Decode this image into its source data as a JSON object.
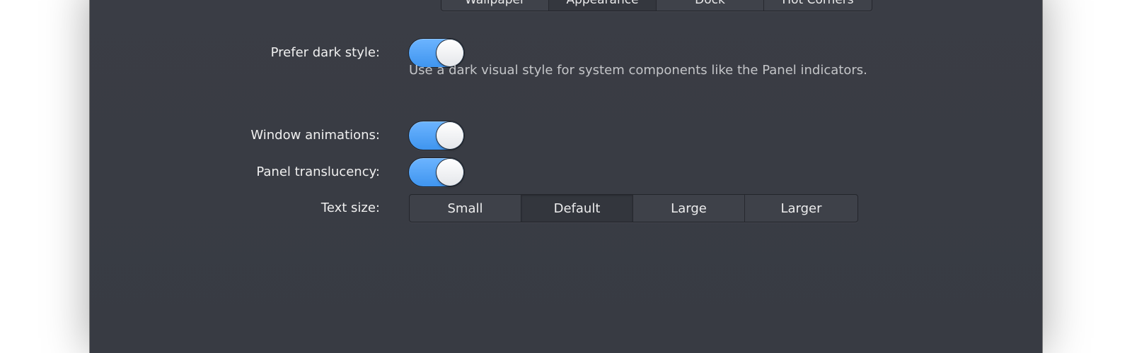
{
  "tabs": [
    {
      "label": "Wallpaper",
      "active": false
    },
    {
      "label": "Appearance",
      "active": true
    },
    {
      "label": "Dock",
      "active": false
    },
    {
      "label": "Hot Corners",
      "active": false
    }
  ],
  "settings": {
    "dark_style": {
      "label": "Prefer dark style:",
      "enabled": true,
      "description": "Use a dark visual style for system components like the Panel indicators."
    },
    "window_animations": {
      "label": "Window animations:",
      "enabled": true
    },
    "panel_translucency": {
      "label": "Panel translucency:",
      "enabled": true
    },
    "text_size": {
      "label": "Text size:",
      "options": [
        "Small",
        "Default",
        "Large",
        "Larger"
      ],
      "selected": "Default"
    }
  },
  "colors": {
    "window_bg": "#393c44",
    "accent": "#4a9ff5"
  }
}
